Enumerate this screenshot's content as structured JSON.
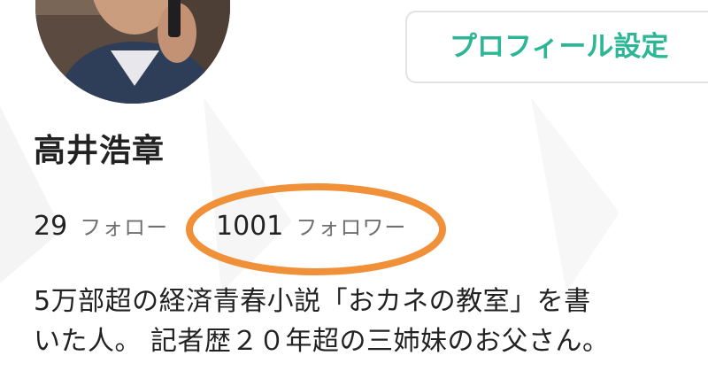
{
  "profile": {
    "settings_button_label": "プロフィール設定",
    "name": "高井浩章",
    "following_count": "29",
    "following_label": "フォロー",
    "followers_count": "1001",
    "followers_label": "フォロワー",
    "bio_lines": [
      "5万部超の経済青春小説「おカネの教室」を書",
      "いた人。 記者歴２０年超の三姉妹のお父さん。"
    ]
  },
  "colors": {
    "accent": "#2cb696",
    "highlight": "#f0913a",
    "text": "#222222",
    "muted": "#707070",
    "border": "#e2e2e2"
  }
}
